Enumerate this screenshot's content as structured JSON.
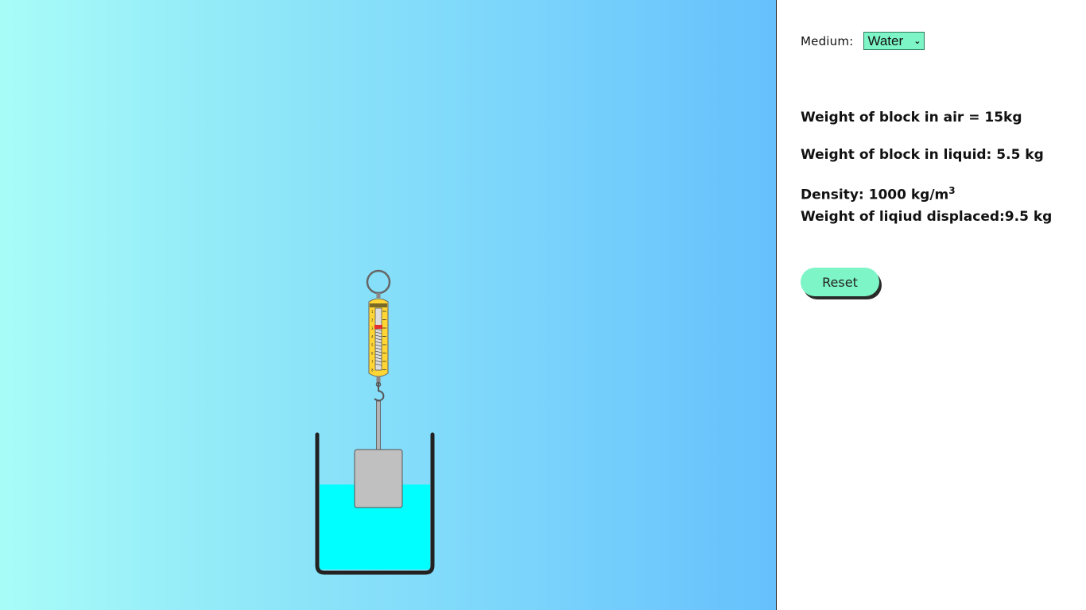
{
  "controls": {
    "medium_label": "Medium:",
    "medium_value": "Water",
    "medium_icon": "chevron-down-icon",
    "reset_label": "Reset"
  },
  "readings": {
    "air_weight": "Weight of block in air = 15kg",
    "liquid_weight": "Weight of block in liquid: 5.5 kg",
    "density_text": "Density: 1000 kg/m",
    "density_exp": "3",
    "displaced": "Weight of liqiud displaced:9.5 kg"
  },
  "scale": {
    "ticks": [
      "1",
      "2",
      "3",
      "4",
      "5",
      "6",
      "7",
      "8"
    ]
  },
  "colors": {
    "liquid": "#00ffff",
    "block": "#c0c0c0",
    "scale_body": "#ffd633",
    "button": "#7df5c6",
    "select": "#7df5c6"
  }
}
